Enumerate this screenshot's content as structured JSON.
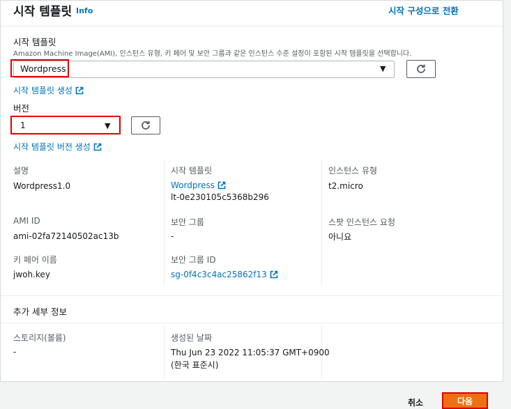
{
  "header": {
    "title": "시작 템플릿",
    "info": "Info",
    "switch_link": "시작 구성으로 전환"
  },
  "template_field": {
    "label": "시작 템플릿",
    "description": "Amazon Machine Image(AMI), 인스턴스 유형, 키 페어 및 보안 그룹과 같은 인스턴스 수준 설정이 포함된 시작 템플릿을 선택합니다.",
    "value": "Wordpress",
    "create_link": "시작 템플릿 생성"
  },
  "version_field": {
    "label": "버전",
    "value": "1",
    "create_link": "시작 템플릿 버전 생성"
  },
  "details": {
    "description_label": "설명",
    "description_value": "Wordpress1.0",
    "template_label": "시작 템플릿",
    "template_link": "Wordpress",
    "template_id": "lt-0e230105c5368b296",
    "instance_type_label": "인스턴스 유형",
    "instance_type_value": "t2.micro",
    "ami_label": "AMI ID",
    "ami_value": "ami-02fa72140502ac13b",
    "sg_label": "보안 그룹",
    "sg_value": "-",
    "spot_label": "스팟 인스턴스 요청",
    "spot_value": "아니요",
    "keypair_label": "키 페어 이름",
    "keypair_value": "jwoh.key",
    "sgid_label": "보안 그룹 ID",
    "sgid_value": "sg-0f4c3c4ac25862f13"
  },
  "additional": {
    "heading": "추가 세부 정보",
    "storage_label": "스토리지(볼륨)",
    "storage_value": "-",
    "created_label": "생성된 날짜",
    "created_line1": "Thu Jun 23 2022 11:05:37 GMT+0900",
    "created_line2": "(한국 표준시)"
  },
  "footer": {
    "cancel": "취소",
    "next": "다음"
  },
  "colors": {
    "link": "#0073bb",
    "primary": "#ec7211",
    "highlight": "#e00000"
  }
}
